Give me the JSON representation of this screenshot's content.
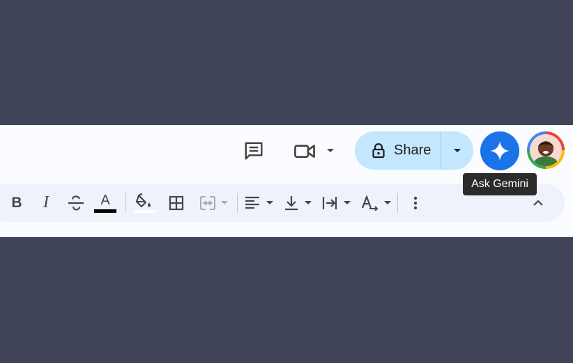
{
  "header": {
    "share_label": "Share",
    "tooltip": "Ask Gemini",
    "icons": [
      "comment-icon",
      "video-camera-icon",
      "caret-down-icon",
      "lock-icon",
      "gemini-sparkle-icon",
      "avatar"
    ]
  },
  "toolbar": {
    "bold_label": "B",
    "italic_label": "I",
    "text_color_label": "A",
    "text_color": "#000000",
    "fill_color": "#ffffff",
    "icons": [
      "bold-icon",
      "italic-icon",
      "strikethrough-icon",
      "text-color-icon",
      "fill-color-icon",
      "borders-icon",
      "merge-cells-icon",
      "horizontal-align-icon",
      "vertical-align-icon",
      "text-wrapping-icon",
      "text-rotation-icon",
      "more-vert-icon",
      "collapse-icon"
    ]
  },
  "colors": {
    "page_background": "#3f4458",
    "share_button": "#c2e7ff",
    "gemini_button": "#1b73e8",
    "toolbar_background": "#eef2fb"
  }
}
